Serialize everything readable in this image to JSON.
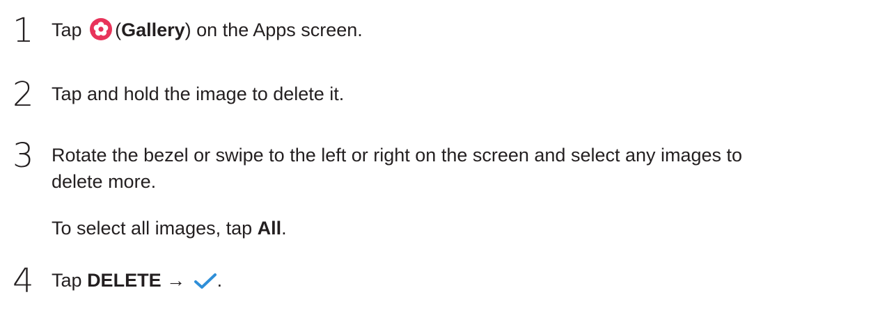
{
  "steps": [
    {
      "number": "1",
      "tap": "Tap",
      "gallery_open": "(",
      "gallery_label": "Gallery",
      "gallery_close": ")",
      "rest": "on the Apps screen.",
      "gallery_icon": "gallery-flower-icon",
      "gallery_icon_color": "#e8335a"
    },
    {
      "number": "2",
      "text": "Tap and hold the image to delete it."
    },
    {
      "number": "3",
      "line1": "Rotate the bezel or swipe to the left or right on the screen and select any images to",
      "line2": "delete more.",
      "note_prefix": "To select all images, tap",
      "note_bold": "All",
      "note_suffix": "."
    },
    {
      "number": "4",
      "tap": "Tap",
      "delete_label": "DELETE",
      "arrow": "→",
      "period": ".",
      "check_icon": "checkmark-icon",
      "check_color": "#2f8fd8"
    }
  ]
}
